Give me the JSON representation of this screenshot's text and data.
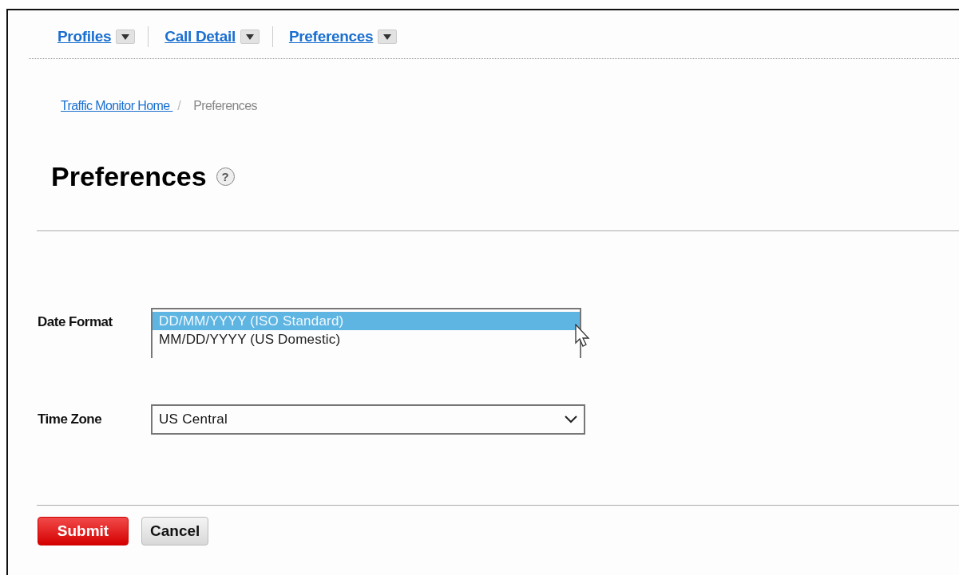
{
  "nav": [
    {
      "label": "Profiles"
    },
    {
      "label": "Call Detail"
    },
    {
      "label": "Preferences"
    }
  ],
  "breadcrumb": {
    "links": [
      "Traffic Monitor Home"
    ],
    "separator": "/",
    "current": "Preferences"
  },
  "title": "Preferences",
  "help": "?",
  "fields": [
    {
      "kind": "listbox",
      "label": "Date Format",
      "options": [
        {
          "label": "DD/MM/YYYY (ISO Standard)",
          "selected": true
        },
        {
          "label": "MM/DD/YYYY (US Domestic)",
          "selected": false
        }
      ]
    },
    {
      "kind": "select",
      "label": "Time Zone",
      "value": "US Central"
    }
  ],
  "buttons": [
    {
      "label": "Submit",
      "kind": "primary"
    },
    {
      "label": "Cancel",
      "kind": "secondary"
    }
  ]
}
